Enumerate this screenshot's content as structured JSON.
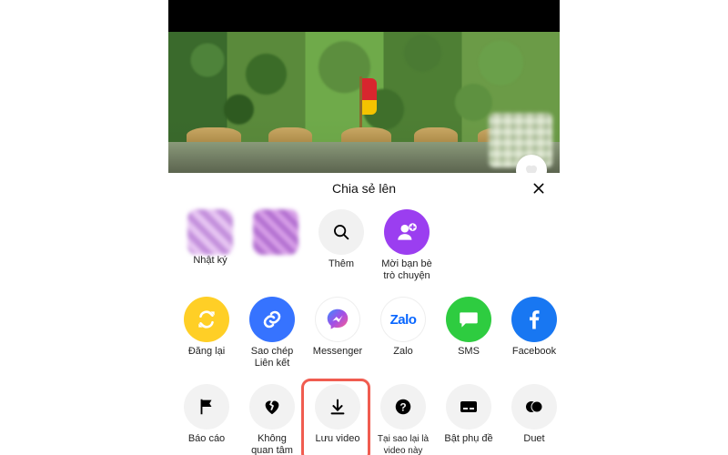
{
  "sheet": {
    "title": "Chia sẻ lên"
  },
  "row1": {
    "items": [
      {
        "label_top": "",
        "label_bottom": "Nhật ký"
      },
      {
        "label_top": "",
        "label_bottom": ""
      },
      {
        "label_top": "Thêm",
        "label_bottom": ""
      },
      {
        "label_top": "Mời bạn bè",
        "label_bottom": "trò chuyện"
      }
    ]
  },
  "row2": {
    "items": [
      {
        "label": "Đăng lại"
      },
      {
        "label_top": "Sao chép",
        "label_bottom": "Liên kết"
      },
      {
        "label": "Messenger"
      },
      {
        "label": "Zalo"
      },
      {
        "label": "SMS"
      },
      {
        "label": "Facebook"
      }
    ]
  },
  "row3": {
    "items": [
      {
        "label": "Báo cáo"
      },
      {
        "label_top": "Không",
        "label_bottom": "quan tâm"
      },
      {
        "label": "Lưu video"
      },
      {
        "label_top": "Tại sao lại là",
        "label_bottom": "video này"
      },
      {
        "label": "Bật phụ đề"
      },
      {
        "label": "Duet"
      }
    ]
  },
  "colors": {
    "highlight": "#f05c50",
    "invite": "#9b3ef0",
    "repost": "#ffcf26",
    "copylink": "#3673ff",
    "sms": "#2ecc40",
    "fb": "#1877f2"
  }
}
